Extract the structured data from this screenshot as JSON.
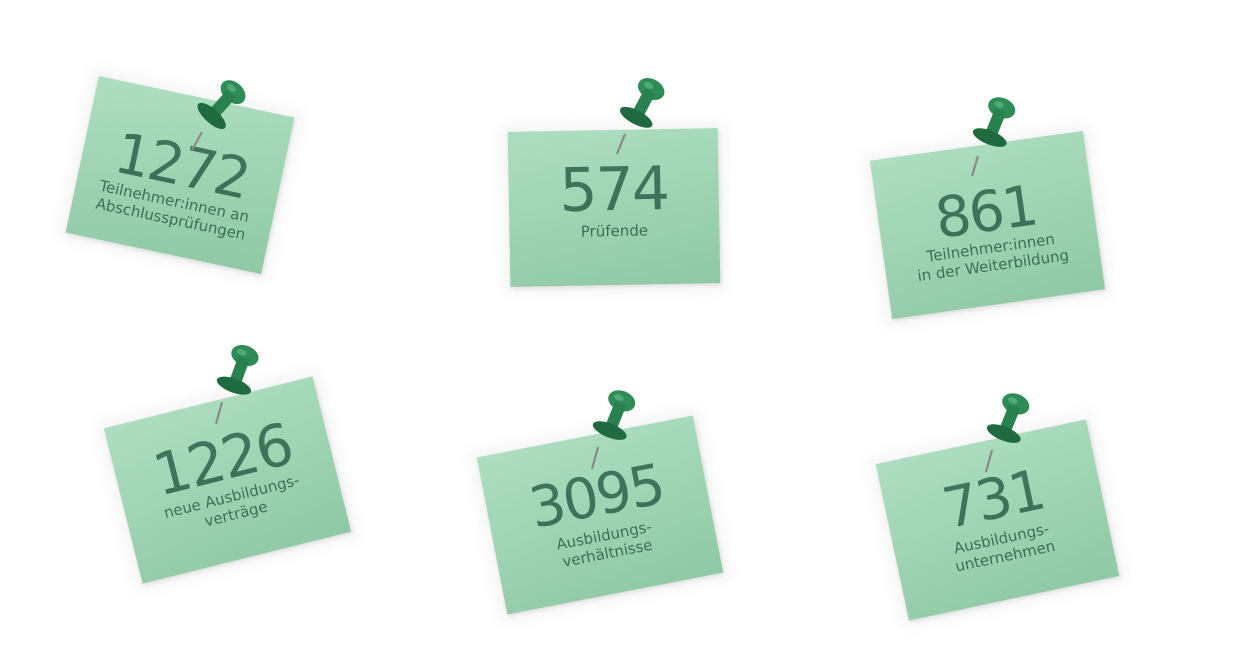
{
  "notes": [
    {
      "id": "participants-final-exams",
      "number": "1272",
      "label_line1": "Teilnehmer:innen an",
      "label_line2": "Abschlussprüfungen"
    },
    {
      "id": "examiners",
      "number": "574",
      "label_line1": "Prüfende",
      "label_line2": ""
    },
    {
      "id": "participants-further-training",
      "number": "861",
      "label_line1": "Teilnehmer:innen",
      "label_line2": "in der Weiterbildung"
    },
    {
      "id": "new-training-contracts",
      "number": "1226",
      "label_line1": "neue Ausbildungs-",
      "label_line2": "verträge"
    },
    {
      "id": "training-relationships",
      "number": "3095",
      "label_line1": "Ausbildungs-",
      "label_line2": "verhältnisse"
    },
    {
      "id": "training-companies",
      "number": "731",
      "label_line1": "Ausbildungs-",
      "label_line2": "unternehmen"
    }
  ],
  "colors": {
    "note": "#a3d8b8",
    "text": "#3a6e56",
    "pin": "#2e8a55",
    "pin_dark": "#1f6b3f",
    "needle": "#8a8a8a"
  },
  "icons": {
    "pin": "pushpin-icon"
  }
}
